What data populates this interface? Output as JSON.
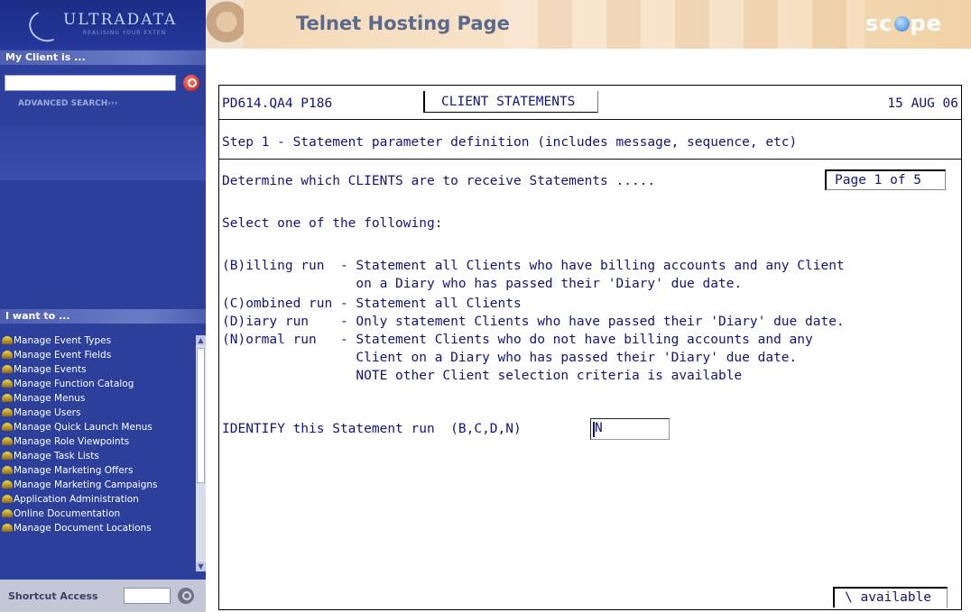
{
  "sidebar": {
    "logo": {
      "name": "ULTRADATA",
      "tagline": "REALISING YOUR EXTEN"
    },
    "client_header": "My Client is ...",
    "client_input_value": "",
    "advanced_search": "ADVANCED SEARCH",
    "iwant_header": "I want to ...",
    "menu_items": [
      "Manage Event Types",
      "Manage Event Fields",
      "Manage Events",
      "Manage Function Catalog",
      "Manage Menus",
      "Manage Users",
      "Manage Quick Launch Menus",
      "Manage Role Viewpoints",
      "Manage Task Lists",
      "Manage Marketing Offers",
      "Manage Marketing Campaigns",
      "Application Administration",
      "Online Documentation",
      "Manage Document Locations"
    ],
    "shortcut_label": "Shortcut Access",
    "shortcut_value": ""
  },
  "banner": {
    "title": "Telnet Hosting Page",
    "brand_left": "sc",
    "brand_right": "pe"
  },
  "terminal": {
    "program_id": "PD614.QA4 P186",
    "screen_title": "CLIENT STATEMENTS",
    "date": "15 AUG 06",
    "step_line": "Step 1 - Statement parameter definition (includes message, sequence, etc)",
    "determine_line": "Determine which CLIENTS are to receive Statements .....",
    "page_indicator": "Page 1 of 5",
    "select_line": "Select one of the following:",
    "options": [
      "(B)illing run  - Statement all Clients who have billing accounts and any Client",
      "                 on a Diary who has passed their 'Diary' due date.",
      "(C)ombined run - Statement all Clients",
      "(D)iary run    - Only statement Clients who have passed their 'Diary' due date.",
      "(N)ormal run   - Statement Clients who do not have billing accounts and any",
      "                 Client on a Diary who has passed their 'Diary' due date.",
      "                 NOTE other Client selection criteria is available"
    ],
    "identify_prompt": "IDENTIFY this Statement run  (B,C,D,N)",
    "identify_value": "N",
    "status": "\\ available"
  }
}
